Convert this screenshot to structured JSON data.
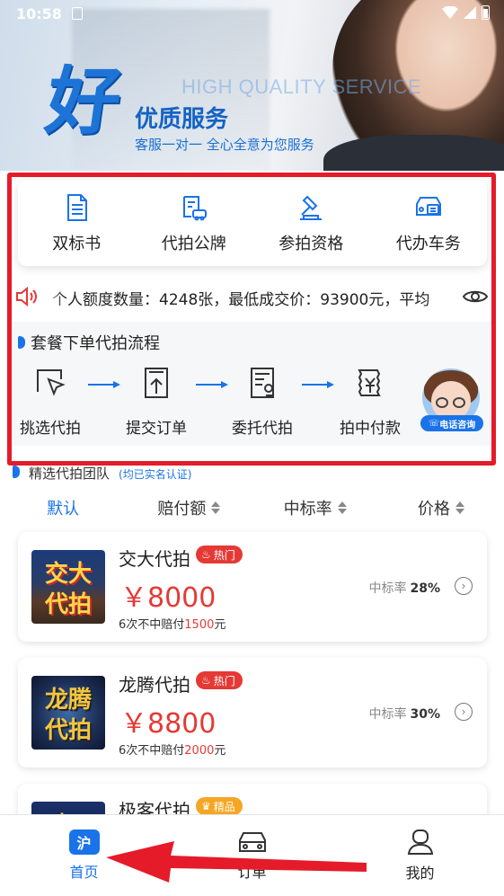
{
  "status": {
    "time": "10:58"
  },
  "banner": {
    "logo_char": "好",
    "english": "HIGH QUALITY SERVICE",
    "title": "优质服务",
    "subtitle": "客服一对一 全心全意为您服务"
  },
  "services": [
    {
      "label": "双标书",
      "icon": "document-icon"
    },
    {
      "label": "代拍公牌",
      "icon": "car-document-icon"
    },
    {
      "label": "参拍资格",
      "icon": "gavel-icon"
    },
    {
      "label": "代办车务",
      "icon": "car-id-icon"
    }
  ],
  "marquee": {
    "text": "个人额度数量：4248张，最低成交价：93900元，平均"
  },
  "process": {
    "title": "套餐下单代拍流程",
    "steps": [
      {
        "label": "挑选代拍",
        "icon": "cursor-select-icon"
      },
      {
        "label": "提交订单",
        "icon": "upload-document-icon"
      },
      {
        "label": "委托代拍",
        "icon": "contract-icon"
      },
      {
        "label": "拍中付款",
        "icon": "payment-icon"
      }
    ],
    "call_label": "电话咨询"
  },
  "team": {
    "title": "精选代拍团队",
    "note": "(均已实名认证)"
  },
  "sort": [
    {
      "label": "默认",
      "active": true
    },
    {
      "label": "赔付额",
      "active": false
    },
    {
      "label": "中标率",
      "active": false
    },
    {
      "label": "价格",
      "active": false
    }
  ],
  "cards": [
    {
      "name": "交大代拍",
      "tag": "热门",
      "tag_type": "hot",
      "thumb_text": [
        "交大",
        "代拍"
      ],
      "price": "￥8000",
      "rate_label": "中标率",
      "rate": "28%",
      "comp_prefix": "6次不中赔付",
      "comp_value": "1500",
      "comp_suffix": "元"
    },
    {
      "name": "龙腾代拍",
      "tag": "热门",
      "tag_type": "hot",
      "thumb_text": [
        "龙腾",
        "代拍"
      ],
      "price": "￥8800",
      "rate_label": "中标率",
      "rate": "30%",
      "comp_prefix": "6次不中赔付",
      "comp_value": "2000",
      "comp_suffix": "元"
    },
    {
      "name": "极客代拍",
      "tag": "精品",
      "tag_type": "best",
      "thumb_text": [
        "极",
        ""
      ]
    }
  ],
  "nav": [
    {
      "label": "首页",
      "active": true,
      "icon_text": "沪"
    },
    {
      "label": "订单",
      "active": false
    },
    {
      "label": "我的",
      "active": false
    }
  ]
}
